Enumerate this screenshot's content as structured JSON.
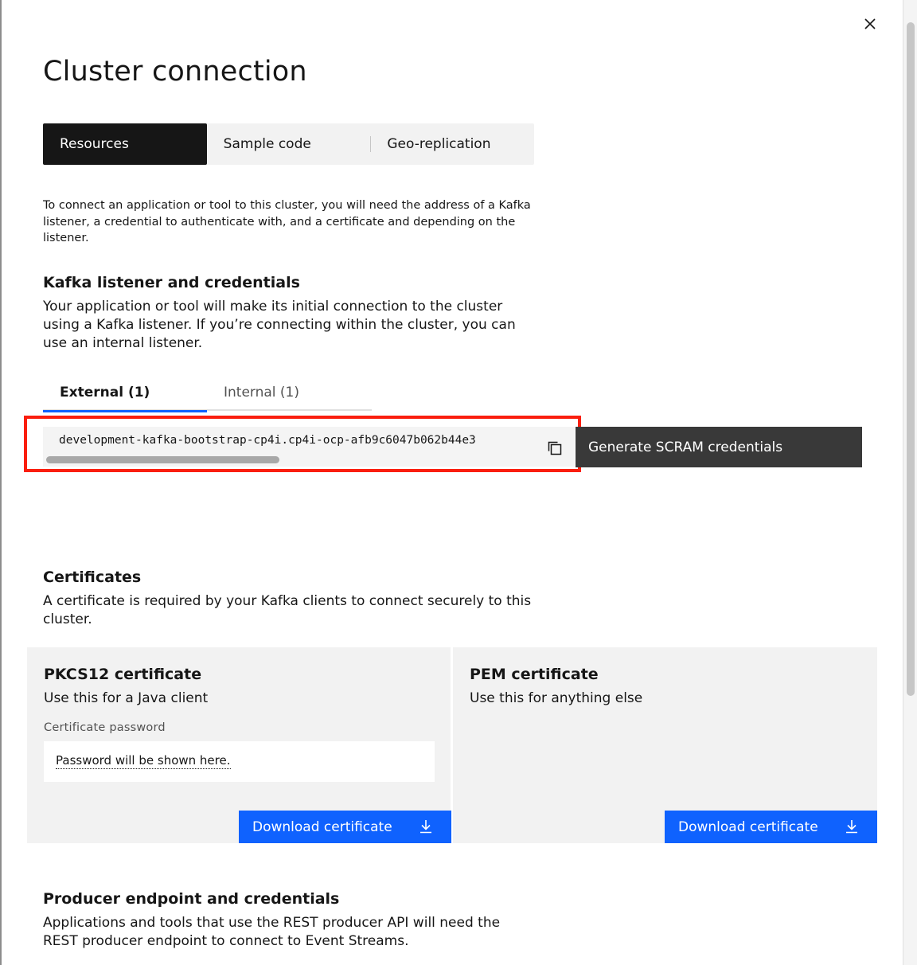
{
  "dialog": {
    "title": "Cluster connection",
    "close_icon": "close-icon"
  },
  "tabs": [
    {
      "label": "Resources",
      "selected": true
    },
    {
      "label": "Sample code",
      "selected": false
    },
    {
      "label": "Geo-replication",
      "selected": false
    }
  ],
  "intro": "To connect an application or tool to this cluster, you will need the address of a Kafka listener, a credential to authenticate with, and a certificate and depending on the listener.",
  "kafka_section": {
    "heading": "Kafka listener and credentials",
    "description": "Your application or tool will make its initial connection to the cluster using a Kafka listener. If you’re connecting within the cluster, you can use an internal listener.",
    "listener_tabs": [
      {
        "label": "External (1)",
        "selected": true
      },
      {
        "label": "Internal (1)",
        "selected": false
      }
    ],
    "listener_address": "development-kafka-bootstrap-cp4i.cp4i-ocp-afb9c6047b062b44e3",
    "copy_icon": "copy-icon",
    "generate_button": "Generate SCRAM credentials"
  },
  "certificates": {
    "heading": "Certificates",
    "description": "A certificate is required by your Kafka clients to connect securely to this cluster.",
    "pkcs12": {
      "title": "PKCS12 certificate",
      "subtitle": "Use this for a Java client",
      "password_label": "Certificate password",
      "password_placeholder": "Password will be shown here.",
      "download_label": "Download certificate",
      "download_icon": "download-icon"
    },
    "pem": {
      "title": "PEM certificate",
      "subtitle": "Use this for anything else",
      "download_label": "Download certificate",
      "download_icon": "download-icon"
    }
  },
  "producer_section": {
    "heading": "Producer endpoint and credentials",
    "description": "Applications and tools that use the REST producer API will need the REST producer endpoint to connect to Event Streams."
  },
  "colors": {
    "primary_button": "#0f62fe",
    "secondary_button": "#393939",
    "active_tab": "#161616",
    "highlight": "#fa1e0e"
  }
}
